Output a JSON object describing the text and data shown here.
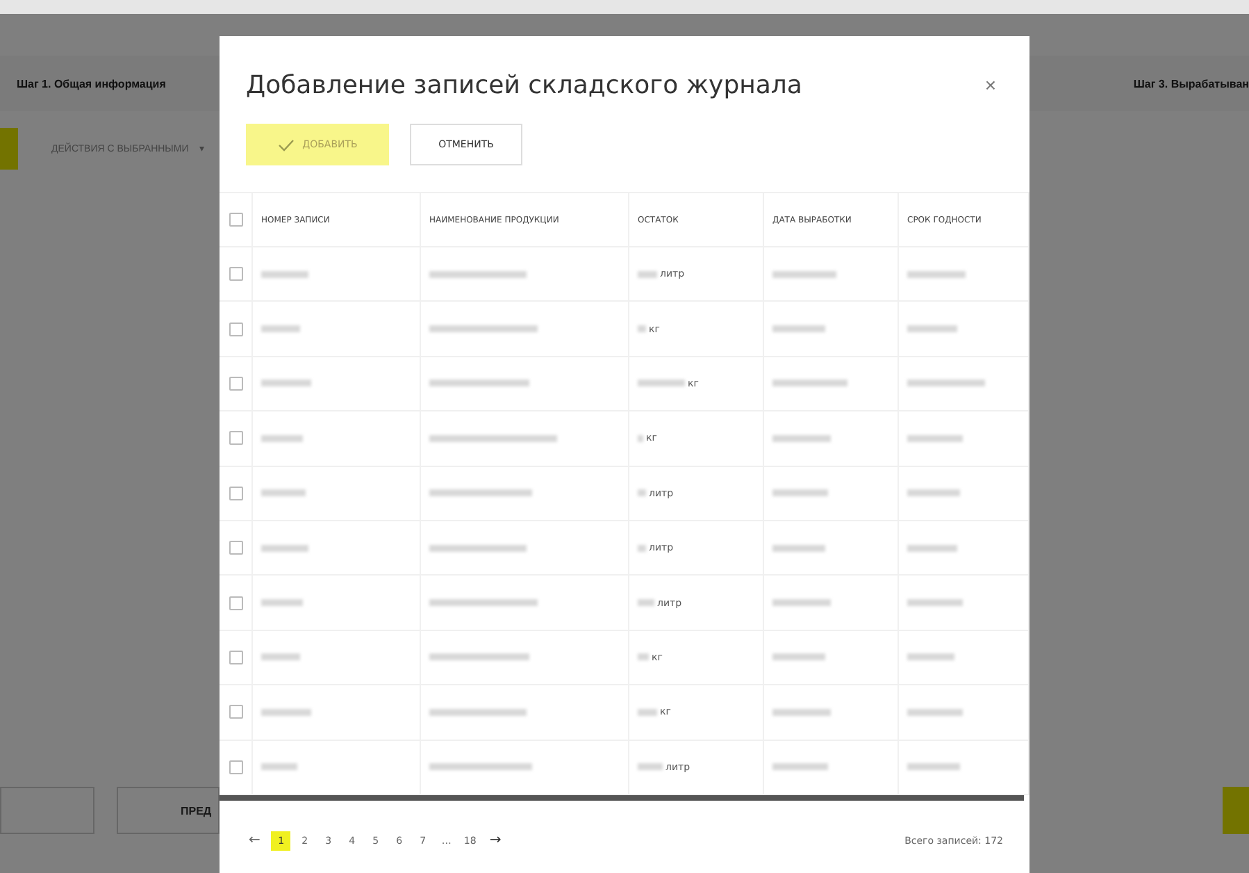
{
  "page": {
    "steps": [
      {
        "label": "Шаг 1. Общая информация"
      },
      {
        "label": "Шаг 3. Вырабатыван"
      }
    ],
    "actions_dropdown": {
      "label": "ДЕЙСТВИЯ С ВЫБРАННЫМИ",
      "caret": "▾"
    },
    "bottom_buttons": [
      {
        "kind": "outline"
      },
      {
        "label": "ПРЕД",
        "kind": "outline"
      },
      {
        "kind": "primary"
      }
    ]
  },
  "modal": {
    "title": "Добавление записей складского журнала",
    "close": "×",
    "buttons": [
      {
        "label": "ДОБАВИТЬ",
        "kind": "primary"
      },
      {
        "label": "ОТМЕНИТЬ",
        "kind": "secondary"
      }
    ],
    "table": {
      "select_all": {
        "checked": false
      },
      "columns": [
        "НОМЕР ЗАПИСИ",
        "НАИМЕНОВАНИЕ ПРОДУКЦИИ",
        "ОСТАТОК",
        "ДАТА ВЫРАБОТКИ",
        "СРОК ГОДНОСТИ"
      ],
      "rows": [
        {
          "checked": false,
          "unit": "литр"
        },
        {
          "checked": false,
          "unit": "кг"
        },
        {
          "checked": false,
          "unit": "кг"
        },
        {
          "checked": false,
          "unit": "кг"
        },
        {
          "checked": false,
          "unit": "литр"
        },
        {
          "checked": false,
          "unit": "литр"
        },
        {
          "checked": false,
          "unit": "литр"
        },
        {
          "checked": false,
          "unit": "кг"
        },
        {
          "checked": false,
          "unit": "кг"
        },
        {
          "checked": false,
          "unit": "литр"
        }
      ]
    },
    "pagination": {
      "prev": "←",
      "next": "→",
      "pages": [
        {
          "label": "1",
          "selected": true
        },
        {
          "label": "2",
          "selected": false
        },
        {
          "label": "3",
          "selected": false
        },
        {
          "label": "4",
          "selected": false
        },
        {
          "label": "5",
          "selected": false
        },
        {
          "label": "6",
          "selected": false
        },
        {
          "label": "7",
          "selected": false
        },
        {
          "label": "…",
          "selected": false
        },
        {
          "label": "18",
          "selected": false
        }
      ],
      "total": "Всего записей: 172"
    }
  }
}
